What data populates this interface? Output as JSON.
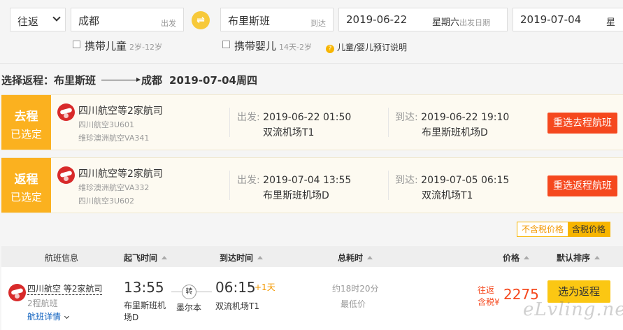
{
  "search": {
    "trip_type": "往返",
    "from": {
      "value": "成都",
      "tag": "出发"
    },
    "to": {
      "value": "布里斯班",
      "tag": "到达"
    },
    "depart_date": {
      "value": "2019-06-22",
      "weekday": "星期六",
      "tag": "出发日期"
    },
    "return_date": {
      "value": "2019-07-04",
      "weekday": "星"
    },
    "options": [
      {
        "label": "携带儿童",
        "age": "2岁-12岁"
      },
      {
        "label": "携带婴儿",
        "age": "14天-2岁"
      }
    ],
    "help_link": "儿童/婴儿预订说明"
  },
  "heading": {
    "prefix": "选择返程：",
    "from": "布里斯班",
    "to": "成都",
    "date": "2019-07-04周四"
  },
  "legs": [
    {
      "badge_title": "去程",
      "badge_sub": "已选定",
      "airline": "四川航空等2家航司",
      "flight1": "四川航空3U601",
      "flight2": "维珍澳洲航空VA341",
      "dep_label": "出发:",
      "dep_time": "2019-06-22 01:50",
      "dep_airport": "双流机场T1",
      "arr_label": "到达:",
      "arr_time": "2019-06-22 19:10",
      "arr_airport": "布里斯班机场D",
      "button": "重选去程航班"
    },
    {
      "badge_title": "返程",
      "badge_sub": "已选定",
      "airline": "四川航空等2家航司",
      "flight1": "维珍澳洲航空VA332",
      "flight2": "四川航空3U602",
      "dep_label": "出发:",
      "dep_time": "2019-07-04 13:55",
      "dep_airport": "布里斯班机场D",
      "arr_label": "到达:",
      "arr_time": "2019-07-05 06:15",
      "arr_airport": "双流机场T1",
      "button": "重选返程航班"
    }
  ],
  "tax_toggle": {
    "excl": "不含税价格",
    "incl": "含税价格"
  },
  "list_header": {
    "info": "航班信息",
    "dep": "起飞时间",
    "arr": "到达时间",
    "duration": "总耗时",
    "price": "价格",
    "sort": "默认排序"
  },
  "flight": {
    "airline": "四川航空 等2家航司",
    "legs": "2程航班",
    "details": "航班详情",
    "dep_time": "13:55",
    "dep_airport": "布里斯班机场D",
    "transfer": "转",
    "via": "墨尔本",
    "arr_time": "06:15",
    "day_offset": "+1天",
    "arr_airport": "双流机场T1",
    "duration": "约18时20分",
    "lowest": "最低价",
    "price_label1": "往返",
    "price_label2": "含税¥",
    "price": "2275",
    "select": "选为返程"
  },
  "watermark": "eLvling.net"
}
